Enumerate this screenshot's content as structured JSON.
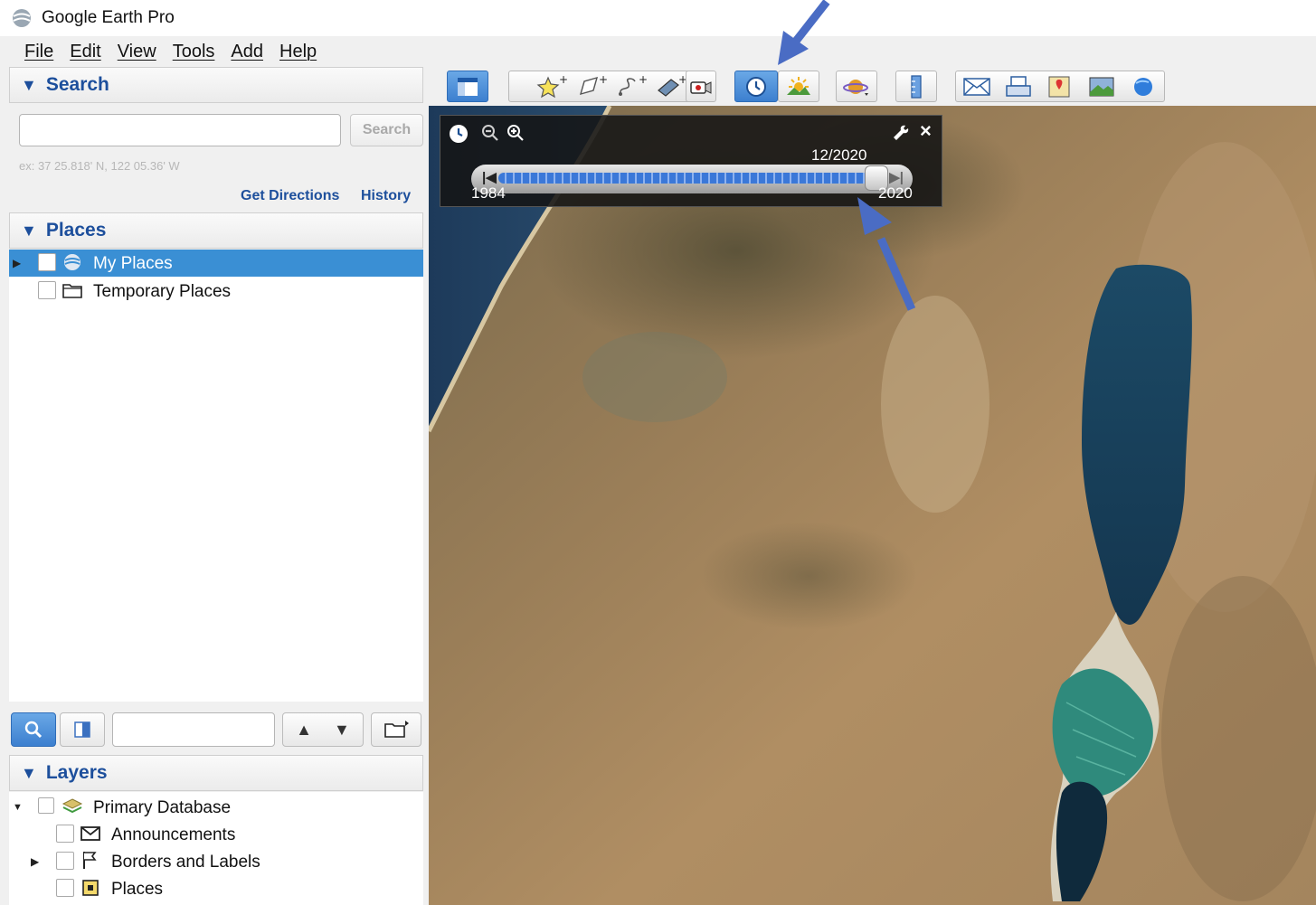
{
  "window": {
    "title": "Google Earth Pro"
  },
  "menu": {
    "items": [
      {
        "label": "File"
      },
      {
        "label": "Edit"
      },
      {
        "label": "View"
      },
      {
        "label": "Tools"
      },
      {
        "label": "Add"
      },
      {
        "label": "Help"
      }
    ]
  },
  "search": {
    "header": "Search",
    "input_value": "",
    "button_label": "Search",
    "example_hint": "ex: 37 25.818' N, 122 05.36' W",
    "get_directions": "Get Directions",
    "history": "History"
  },
  "places": {
    "header": "Places",
    "items": [
      {
        "label": "My Places",
        "selected": true,
        "icon": "earth-icon"
      },
      {
        "label": "Temporary Places",
        "selected": false,
        "icon": "folder-icon"
      }
    ]
  },
  "layers": {
    "header": "Layers",
    "items": [
      {
        "label": "Primary Database",
        "icon": "layers-stack-icon"
      },
      {
        "label": "Announcements",
        "icon": "envelope-icon"
      },
      {
        "label": "Borders and Labels",
        "icon": "flag-icon"
      },
      {
        "label": "Places",
        "icon": "place-square-icon"
      }
    ]
  },
  "toolbar": {
    "buttons": [
      {
        "name": "sidebar-toggle-icon",
        "active": false
      },
      {
        "name": "add-placemark-icon",
        "active": false
      },
      {
        "name": "add-polygon-icon",
        "active": false
      },
      {
        "name": "add-path-icon",
        "active": false
      },
      {
        "name": "add-image-overlay-icon",
        "active": false
      },
      {
        "name": "record-tour-icon",
        "active": false
      },
      {
        "name": "historical-imagery-icon",
        "active": true
      },
      {
        "name": "sunlight-icon",
        "active": false
      },
      {
        "name": "switch-planet-icon",
        "active": false
      },
      {
        "name": "ruler-icon",
        "active": false
      },
      {
        "name": "email-icon",
        "active": false
      },
      {
        "name": "print-icon",
        "active": false
      },
      {
        "name": "view-in-maps-icon",
        "active": false
      },
      {
        "name": "save-image-icon",
        "active": false
      },
      {
        "name": "earth-view-icon",
        "active": false
      }
    ]
  },
  "time_slider": {
    "current_date": "12/2020",
    "start_year": "1984",
    "end_year": "2020",
    "position_fraction": 1.0
  },
  "colors": {
    "accent": "#1d4f9c",
    "selection": "#3a8fd4",
    "annotation_arrow": "#4a6cc4"
  }
}
